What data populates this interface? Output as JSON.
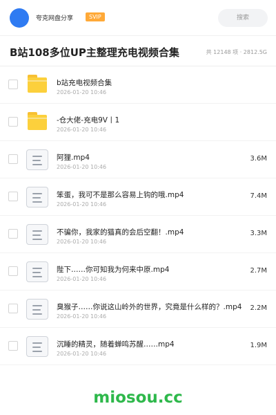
{
  "header": {
    "username": "夸克网盘分享",
    "badge": "SVIP",
    "search_placeholder": "搜索"
  },
  "share": {
    "title": "B站108多位UP主整理充电视频合集",
    "meta": "共 12148 项 · 2812.5G"
  },
  "files": [
    {
      "type": "folder",
      "name": "b站充电视频合集",
      "date": "2026-01-20 10:46",
      "size": ""
    },
    {
      "type": "folder",
      "name": "-仓大佬-充电9V丨1",
      "date": "2026-01-20 10:46",
      "size": ""
    },
    {
      "type": "file",
      "name": "阿狸.mp4",
      "date": "2026-01-20 10:46",
      "size": "3.6M"
    },
    {
      "type": "file",
      "name": "笨蛋，我可不是那么容易上钩的哦.mp4",
      "date": "2026-01-20 10:46",
      "size": "7.4M"
    },
    {
      "type": "file",
      "name": "不骗你，我家的猫真的会后空翻！.mp4",
      "date": "2026-01-20 10:46",
      "size": "3.3M"
    },
    {
      "type": "file",
      "name": "陛下……你可知我为何来中原.mp4",
      "date": "2026-01-20 10:46",
      "size": "2.7M"
    },
    {
      "type": "file",
      "name": "臭猴子……你说这山岭外的世界，究竟是什么样的？.mp4",
      "date": "2026-01-20 10:46",
      "size": "2.2M"
    },
    {
      "type": "file",
      "name": "沉睡的精灵，随着蝉鸣苏醒……mp4",
      "date": "2026-01-20 10:46",
      "size": "1.9M"
    }
  ],
  "footer": {
    "brand": "miosou.cc"
  },
  "colors": {
    "avatar": "#2f7bf2",
    "badge": "#ffa938",
    "folder": "#fcd03c",
    "brand": "#2eb84b"
  }
}
